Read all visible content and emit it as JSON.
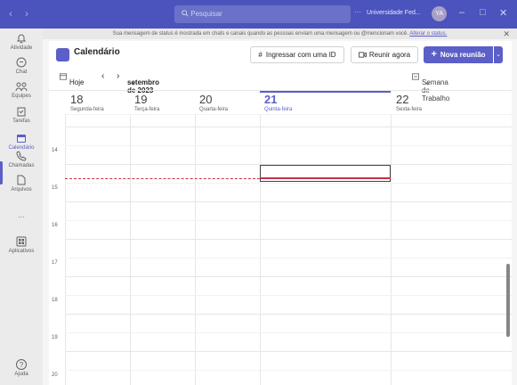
{
  "titlebar": {
    "back": "‹",
    "forward": "›",
    "search_placeholder": "Pesquisar",
    "more": "···",
    "org_name": "Universidade Fed...",
    "avatar_initials": "YA",
    "minimize": "–",
    "maximize": "□",
    "close": "✕"
  },
  "rail": [
    {
      "label": "Atividade",
      "icon": "bell-icon"
    },
    {
      "label": "Chat",
      "icon": "chat-icon"
    },
    {
      "label": "Equipes",
      "icon": "teams-icon"
    },
    {
      "label": "Tarefas",
      "icon": "tasks-icon"
    },
    {
      "label": "Calendário",
      "icon": "calendar-icon",
      "active": true
    },
    {
      "label": "Chamadas",
      "icon": "phone-icon"
    },
    {
      "label": "Arquivos",
      "icon": "file-icon"
    },
    {
      "label": "···",
      "icon": "more-icon"
    },
    {
      "label": "Aplicativos",
      "icon": "apps-icon"
    },
    {
      "label": "Ajuda",
      "icon": "help-icon"
    }
  ],
  "banner": {
    "text": "Sua mensagem de status é mostrada em chats e canais quando as pessoas enviam uma mensagem ou @mencionam você.",
    "link": "Alterar o status.",
    "close": "✕"
  },
  "header": {
    "title": "Calendário",
    "join_id": "Ingressar com uma ID",
    "meet_now": "Reunir agora",
    "new_meeting": "Nova reunião",
    "new_meeting_plus": "+",
    "split": "⌄"
  },
  "nav": {
    "today": "Hoje",
    "prev": "‹",
    "next": "›",
    "month": "setembro de 2023",
    "month_caret": "⌄",
    "view": "Semana de Trabalho",
    "view_caret": "⌄"
  },
  "days": [
    {
      "num": "18",
      "name": "Segunda-feira"
    },
    {
      "num": "19",
      "name": "Terça-feira"
    },
    {
      "num": "20",
      "name": "Quarta-feira"
    },
    {
      "num": "21",
      "name": "Quinta-feira",
      "today": true
    },
    {
      "num": "22",
      "name": "Sexta-feira"
    }
  ],
  "hours": [
    "14",
    "15",
    "16",
    "17",
    "18",
    "19",
    "20"
  ],
  "colors": {
    "accent": "#5b5fc7",
    "titlebar": "#4b53bc",
    "now_line": "#c4314b"
  }
}
